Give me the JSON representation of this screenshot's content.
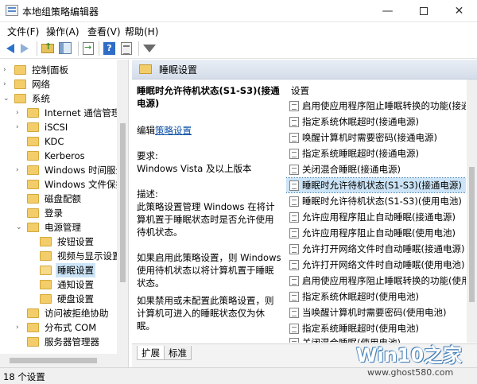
{
  "window": {
    "title": "本地组策略编辑器"
  },
  "menu": [
    "文件(F)",
    "操作(A)",
    "查看(V)",
    "帮助(H)"
  ],
  "toolbar": {
    "icons": [
      "back-icon",
      "forward-icon",
      "up-folder-icon",
      "show-tree-icon",
      "export-list-icon",
      "help-icon",
      "properties-icon",
      "filter-icon"
    ]
  },
  "tree": {
    "items": [
      {
        "label": "控制面板",
        "expander": "›"
      },
      {
        "label": "网络",
        "expander": "›"
      },
      {
        "label": "系统",
        "expander": "⌄"
      },
      {
        "label": "Internet 通信管理",
        "expander": "›"
      },
      {
        "label": "iSCSI",
        "expander": "›"
      },
      {
        "label": "KDC",
        "expander": ""
      },
      {
        "label": "Kerberos",
        "expander": ""
      },
      {
        "label": "Windows 时间服务",
        "expander": "›"
      },
      {
        "label": "Windows 文件保护",
        "expander": ""
      },
      {
        "label": "磁盘配额",
        "expander": ""
      },
      {
        "label": "登录",
        "expander": ""
      },
      {
        "label": "电源管理",
        "expander": "⌄"
      },
      {
        "label": "按钮设置",
        "expander": ""
      },
      {
        "label": "视频与显示设置",
        "expander": ""
      },
      {
        "label": "睡眠设置",
        "expander": ""
      },
      {
        "label": "通知设置",
        "expander": ""
      },
      {
        "label": "硬盘设置",
        "expander": ""
      },
      {
        "label": "访问被拒绝协助",
        "expander": ""
      },
      {
        "label": "分布式 COM",
        "expander": "›"
      },
      {
        "label": "服务器管理器",
        "expander": ""
      }
    ]
  },
  "pane": {
    "header": "睡眠设置",
    "policy_title": "睡眠时允许待机状态(S1-S3)(接通电源)",
    "edit_prefix": "编辑",
    "edit_link": "策略设置",
    "requirement_label": "要求:",
    "requirement_value": "Windows Vista 及以上版本",
    "description_label": "描述:",
    "description_1": "此策略设置管理 Windows 在将计算机置于睡眠状态时是否允许使用待机状态。",
    "description_2": "如果启用此策略设置，则 Windows 使用待机状态以将计算机置于睡眠状态。",
    "description_3": "如果禁用或未配置此策略设置，则计算机可进入的睡眠状态仅为休眠。"
  },
  "settings": {
    "header": "设置",
    "items": [
      "启用使应用程序阻止睡眠转换的功能(接通",
      "指定系统休眠超时(接通电源)",
      "唤醒计算机时需要密码(接通电源)",
      "指定系统睡眠超时(接通电源)",
      "关闭混合睡眠(接通电源)",
      "睡眠时允许待机状态(S1-S3)(接通电源)",
      "睡眠时允许待机状态(S1-S3)(使用电池)",
      "允许应用程序阻止自动睡眠(接通电源)",
      "允许应用程序阻止自动睡眠(使用电池)",
      "允许打开网络文件时自动睡眠(接通电源)",
      "允许打开网络文件时自动睡眠(使用电池)",
      "启用使应用程序阻止睡眠转换的功能(使用",
      "指定系统休眠超时(使用电池)",
      "当唤醒计算机时需要密码(使用电池)",
      "指定系统睡眠超时(使用电池)",
      "关闭混合睡眠(使用电池)"
    ]
  },
  "tabs": [
    "扩展",
    "标准"
  ],
  "status": {
    "text": "18 个设置"
  },
  "watermark": {
    "logo": "Win10之家",
    "url": "www.ghost580.com"
  },
  "colors": {
    "selection": "#cce4f7",
    "link": "#0b50a6",
    "header_bg": "#dfe6ef"
  }
}
